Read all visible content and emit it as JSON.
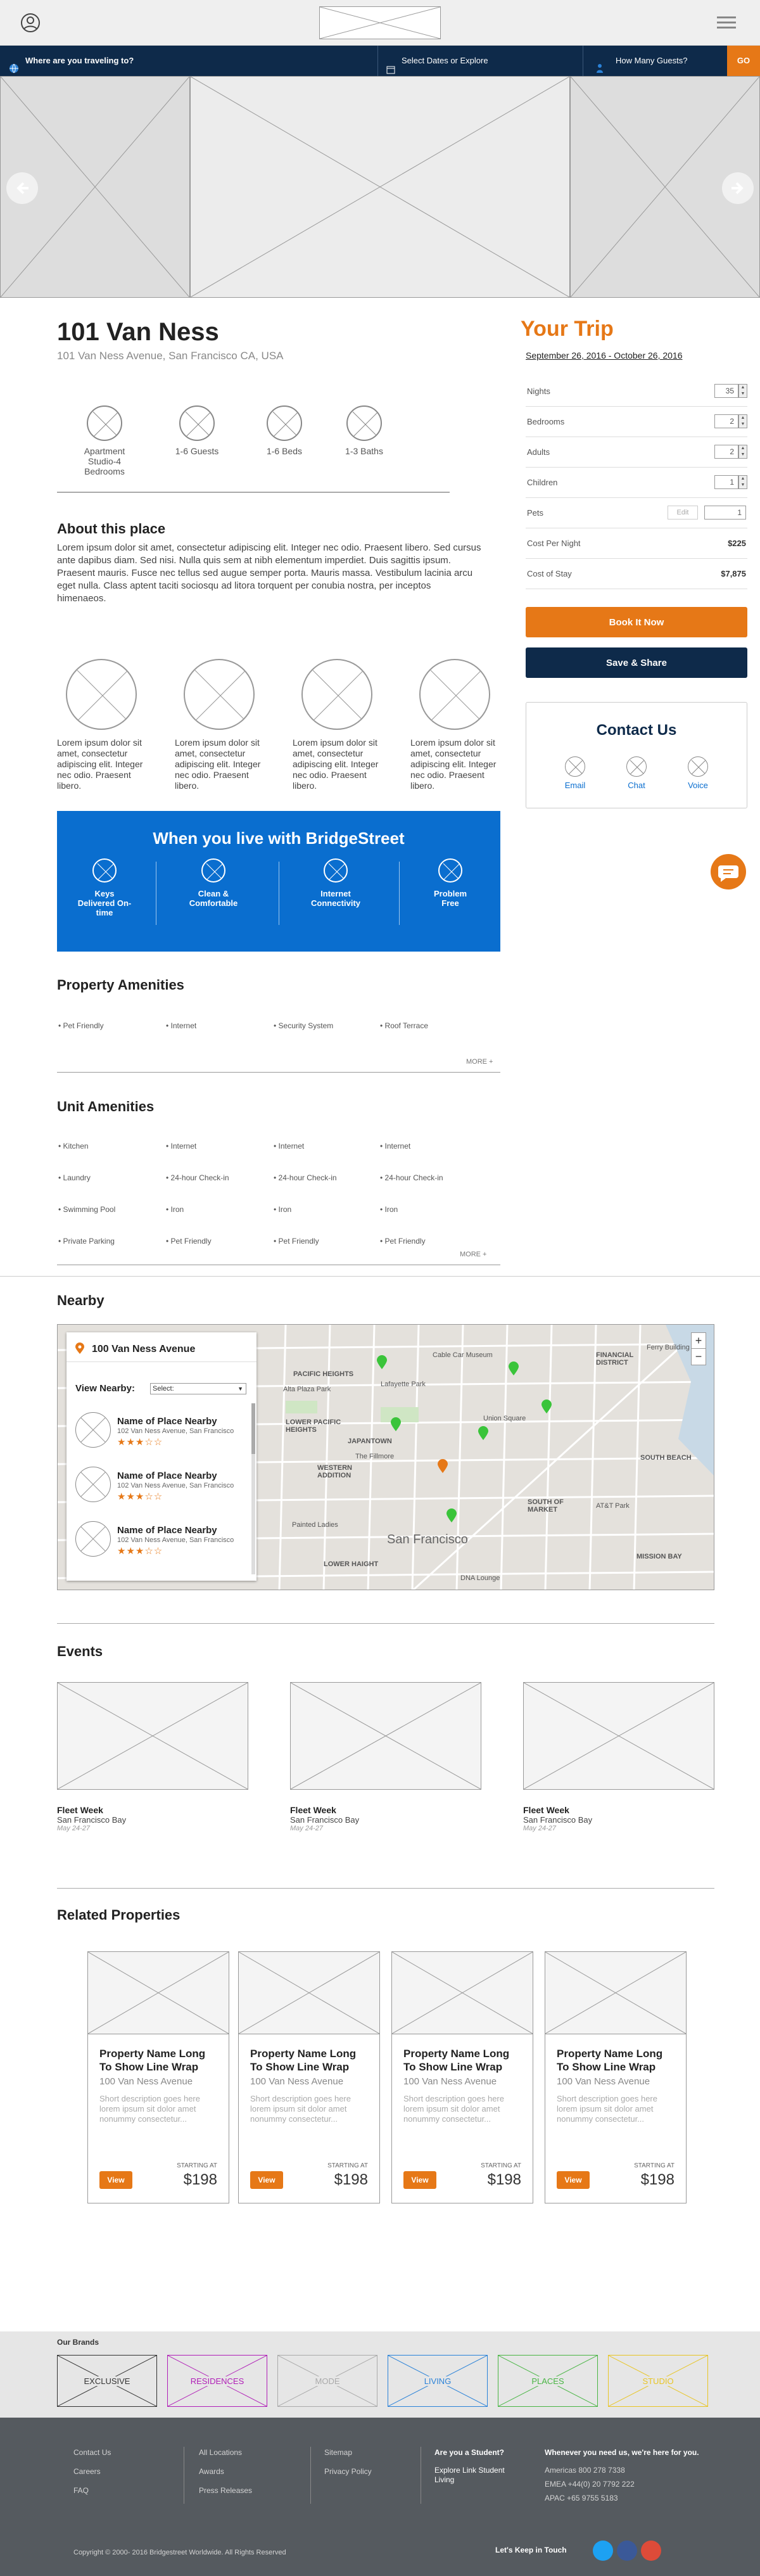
{
  "header": {
    "user_icon": "user-circle-icon",
    "logo_icon": "logo-placeholder",
    "menu_icon": "hamburger-icon"
  },
  "search": {
    "destination": "Where are you traveling to?",
    "dates": "Select Dates or Explore",
    "guests": "How Many Guests?",
    "go": "GO"
  },
  "property": {
    "title": "101 Van Ness",
    "address": "101 Van Ness Avenue, San Francisco CA, USA",
    "features": [
      {
        "label": "Apartment",
        "sub": "Studio-4 Bedrooms"
      },
      {
        "label": "1-6 Guests"
      },
      {
        "label": "1-6 Beds"
      },
      {
        "label": "1-3 Baths"
      }
    ]
  },
  "about": {
    "heading": "About this place",
    "text": "Lorem ipsum dolor sit amet, consectetur adipiscing elit. Integer nec odio. Praesent libero. Sed cursus ante dapibus diam. Sed nisi. Nulla quis sem at nibh elementum imperdiet. Duis sagittis ipsum. Praesent mauris. Fusce nec tellus sed augue semper porta. Mauris massa. Vestibulum lacinia arcu eget nulla. Class aptent taciti sociosqu ad litora torquent per conubia nostra, per inceptos himenaeos.",
    "highlights": [
      "Lorem ipsum dolor sit amet, consectetur adipiscing elit. Integer nec odio. Praesent libero.",
      "Lorem ipsum dolor sit amet, consectetur adipiscing elit. Integer nec odio. Praesent libero.",
      "Lorem ipsum dolor sit amet, consectetur adipiscing elit. Integer nec odio. Praesent libero.",
      "Lorem ipsum dolor sit amet, consectetur adipiscing elit. Integer nec odio. Praesent libero."
    ]
  },
  "benefits": {
    "heading": "When you live with BridgeStreet",
    "items": [
      "Keys Delivered On-time",
      "Clean & Comfortable",
      "Internet Connectivity",
      "Problem Free"
    ]
  },
  "property_amenities": {
    "heading": "Property Amenities",
    "items": [
      "Pet Friendly",
      "Internet",
      "Security System",
      "Roof Terrace"
    ],
    "more": "MORE +"
  },
  "unit_amenities": {
    "heading": "Unit Amenities",
    "rows": [
      [
        "Kitchen",
        "Internet",
        "Internet",
        "Internet"
      ],
      [
        "Laundry",
        "24-hour Check-in",
        "24-hour Check-in",
        "24-hour Check-in"
      ],
      [
        "Swimming Pool",
        "Iron",
        "Iron",
        "Iron"
      ],
      [
        "Private Parking",
        "Pet Friendly",
        "Pet Friendly",
        "Pet Friendly"
      ]
    ],
    "more": "MORE +"
  },
  "nearby": {
    "heading": "Nearby",
    "address": "100 Van Ness Avenue",
    "view_label": "View Nearby:",
    "select": "Select:",
    "places": [
      {
        "name": "Name of Place Nearby",
        "addr": "102 Van Ness Avenue, San Francisco",
        "stars": "★★★☆☆"
      },
      {
        "name": "Name of Place Nearby",
        "addr": "102 Van Ness Avenue, San Francisco",
        "stars": "★★★☆☆"
      },
      {
        "name": "Name of Place Nearby",
        "addr": "102 Van Ness Avenue, San Francisco",
        "stars": "★★★☆☆"
      }
    ],
    "map_labels": [
      "PACIFIC HEIGHTS",
      "Alta Plaza Park",
      "Lafayette Park",
      "Cable Car Museum",
      "FINANCIAL DISTRICT",
      "Ferry Building",
      "Union Square",
      "JAPANTOWN",
      "The Fillmore",
      "LOWER PACIFIC HEIGHTS",
      "WESTERN ADDITION",
      "SOUTH BEACH",
      "SOUTH OF MARKET",
      "AT&T Park",
      "Painted Ladies",
      "San Francisco",
      "LOWER HAIGHT",
      "MISSION BAY",
      "DNA Lounge"
    ],
    "zoom_in": "+",
    "zoom_out": "−"
  },
  "events": {
    "heading": "Events",
    "items": [
      {
        "name": "Fleet Week",
        "location": "San Francisco Bay",
        "date": "May 24-27"
      },
      {
        "name": "Fleet Week",
        "location": "San Francisco Bay",
        "date": "May 24-27"
      },
      {
        "name": "Fleet Week",
        "location": "San Francisco Bay",
        "date": "May 24-27"
      }
    ]
  },
  "related": {
    "heading": "Related Properties",
    "items": [
      {
        "name": "Property Name Long To Show Line Wrap",
        "address": "100 Van Ness Avenue",
        "desc": "Short description goes here lorem ipsum sit dolor amet nonummy consectetur...",
        "starting": "STARTING AT",
        "price": "$198",
        "view": "View"
      },
      {
        "name": "Property Name Long To Show Line Wrap",
        "address": "100 Van Ness Avenue",
        "desc": "Short description goes here lorem ipsum sit dolor amet nonummy consectetur...",
        "starting": "STARTING AT",
        "price": "$198",
        "view": "View"
      },
      {
        "name": "Property Name Long To Show Line Wrap",
        "address": "100 Van Ness Avenue",
        "desc": "Short description goes here lorem ipsum sit dolor amet nonummy consectetur...",
        "starting": "STARTING AT",
        "price": "$198",
        "view": "View"
      },
      {
        "name": "Property Name Long To Show Line Wrap",
        "address": "100 Van Ness Avenue",
        "desc": "Short description goes here lorem ipsum sit dolor amet nonummy consectetur...",
        "starting": "STARTING AT",
        "price": "$198",
        "view": "View"
      }
    ]
  },
  "trip": {
    "heading": "Your Trip",
    "dates": "September 26, 2016 - October 26, 2016",
    "fields": [
      {
        "label": "Nights",
        "value": "35"
      },
      {
        "label": "Bedrooms",
        "value": "2"
      },
      {
        "label": "Adults",
        "value": "2"
      },
      {
        "label": "Children",
        "value": "1"
      }
    ],
    "pets": {
      "label": "Pets",
      "edit": "Edit",
      "value": "1"
    },
    "cost_per_night": {
      "label": "Cost Per Night",
      "value": "$225"
    },
    "cost_of_stay": {
      "label": "Cost of Stay",
      "value": "$7,875"
    },
    "book": "Book It Now",
    "save": "Save & Share"
  },
  "contact": {
    "heading": "Contact Us",
    "items": [
      "Email",
      "Chat",
      "Voice"
    ]
  },
  "brands": {
    "heading": "Our Brands",
    "items": [
      {
        "name": "EXCLUSIVE",
        "color": "#333333"
      },
      {
        "name": "RESIDENCES",
        "color": "#b01fb7"
      },
      {
        "name": "MODE",
        "color": "#aaaaaa"
      },
      {
        "name": "LIVING",
        "color": "#2a82d8"
      },
      {
        "name": "PLACES",
        "color": "#49b544"
      },
      {
        "name": "STUDIO",
        "color": "#e8c524"
      }
    ]
  },
  "footer": {
    "col1": [
      "Contact Us",
      "Careers",
      "FAQ"
    ],
    "col2": [
      "All Locations",
      "Awards",
      "Press Releases"
    ],
    "col3": [
      "Sitemap",
      "Privacy Policy"
    ],
    "student_heading": "Are you a Student?",
    "student_link": "Explore Link Student Living",
    "help_heading": "Whenever you need us, we're here for you.",
    "phones": [
      "Americas 800 278 7338",
      "EMEA +44(0) 20 7792 222",
      "APAC +65 9755 5183"
    ],
    "copyright": "Copyright © 2000- 2016 Bridgestreet Worldwide. All Rights Reserved",
    "keep_in_touch": "Let's Keep in Touch",
    "social": [
      {
        "name": "social-twitter",
        "color": "#1da1f2"
      },
      {
        "name": "social-facebook",
        "color": "#3b5998"
      },
      {
        "name": "social-google",
        "color": "#dd4b39"
      }
    ]
  },
  "colors": {
    "accent": "#e67817",
    "navy": "#0e2a4a",
    "blue": "#0a6ecf"
  }
}
